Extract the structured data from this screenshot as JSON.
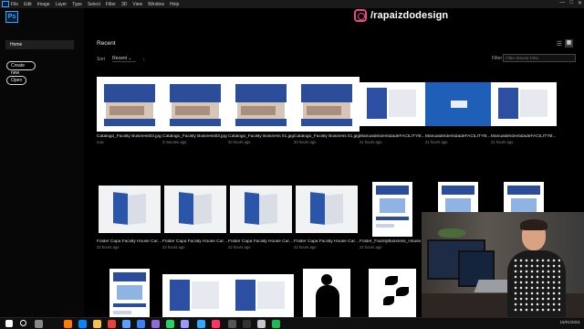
{
  "menubar": {
    "items": [
      "File",
      "Edit",
      "Image",
      "Layer",
      "Type",
      "Select",
      "Filter",
      "3D",
      "View",
      "Window",
      "Help"
    ],
    "controls": [
      "—",
      "□",
      "✕"
    ]
  },
  "app": {
    "logo_text": "Ps",
    "accent": "#31a8ff"
  },
  "left": {
    "home_label": "Home",
    "create_label": "Create new",
    "open_label": "Open"
  },
  "main": {
    "recent_title": "Recent",
    "sort_label": "Sort",
    "sort_value": "Recent",
    "sort_arrow": "↓",
    "filter_label": "Filter",
    "filter_placeholder": "Filter Recent Files"
  },
  "files": [
    {
      "name": "Catalogo_Facility Business03.jpg",
      "time": "now",
      "art": "cover"
    },
    {
      "name": "Catalogo_Facility Business03.jpg",
      "time": "3 minutes ago",
      "art": "cover"
    },
    {
      "name": "Catalogo_Facility Business 01.jpg",
      "time": "20 hours ago",
      "art": "cover"
    },
    {
      "name": "Catalogo_Facility Business 01.jpg",
      "time": "20 hours ago",
      "art": "cover"
    },
    {
      "name": "ManualdeIdentidadeFACILITYB...",
      "time": "21 hours ago",
      "art": "wide"
    },
    {
      "name": "ManualdeIdentidadeFACILITYB...",
      "time": "21 hours ago",
      "art": "bluecard"
    },
    {
      "name": "ManualdeIdentidadeFACILITYB...",
      "time": "21 hours ago",
      "art": "wide"
    },
    {
      "name": "Folder Capa Facility House Care...",
      "time": "22 hours ago",
      "art": "folder"
    },
    {
      "name": "Folder Capa Facility House Care...",
      "time": "22 hours ago",
      "art": "folder"
    },
    {
      "name": "Folder Capa Facility House Care...",
      "time": "22 hours ago",
      "art": "folder"
    },
    {
      "name": "Folder Capa Facility House Care...",
      "time": "22 hours ago",
      "art": "folder"
    },
    {
      "name": "Folder_FacilityBusiness_House...",
      "time": "22 hours ago",
      "art": "poster"
    },
    {
      "name": "",
      "time": "",
      "art": "poster"
    },
    {
      "name": "",
      "time": "",
      "art": "poster"
    },
    {
      "name": "",
      "time": "",
      "art": "poster"
    },
    {
      "name": "",
      "time": "",
      "art": "wide"
    },
    {
      "name": "",
      "time": "",
      "art": "wide"
    },
    {
      "name": "",
      "time": "",
      "art": "silhouette"
    },
    {
      "name": "",
      "time": "",
      "art": "leaves"
    }
  ],
  "overlay": {
    "instagram_handle": "/rapaizdodesign"
  },
  "taskbar": {
    "time": "",
    "date": "15/01/2021",
    "icons": [
      "windows-icon",
      "search-icon",
      "taskview-icon",
      "illustrator-icon",
      "edge-icon",
      "folder-icon",
      "chrome-icon",
      "store-icon",
      "mail-icon",
      "photos-icon",
      "whatsapp-icon",
      "premiere-icon",
      "photoshop-icon",
      "indesign-icon",
      "terminal-icon",
      "obs-icon",
      "browser-icon",
      "spotify-icon"
    ],
    "colors": [
      "#ffffff",
      "#ffffff",
      "#888888",
      "#ff7c00",
      "#0a84ff",
      "#f2c14e",
      "#ea4335",
      "#5aa0ff",
      "#3b82f6",
      "#8e6bd6",
      "#25d366",
      "#9999ff",
      "#31a8ff",
      "#ff3366",
      "#555555",
      "#333333",
      "#c8c8c8",
      "#1db954"
    ]
  }
}
